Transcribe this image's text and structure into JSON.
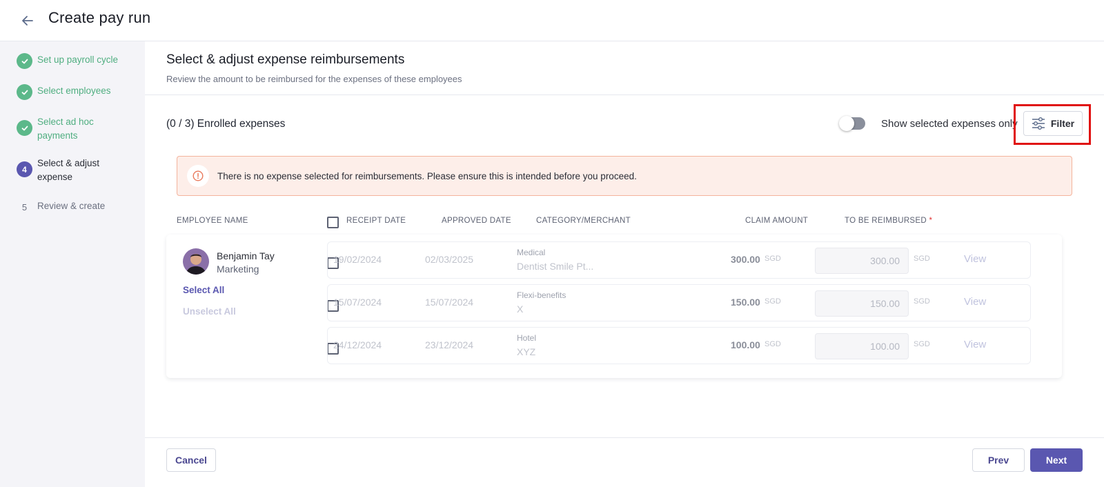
{
  "header": {
    "title": "Create pay run"
  },
  "sidebar": {
    "steps": [
      {
        "number": "1",
        "label": "Set up payroll cycle",
        "state": "done"
      },
      {
        "number": "2",
        "label": "Select employees",
        "state": "done"
      },
      {
        "number": "3",
        "label": "Select ad hoc payments",
        "state": "done"
      },
      {
        "number": "4",
        "label": "Select & adjust expense",
        "state": "active"
      },
      {
        "number": "5",
        "label": "Review & create",
        "state": "pending"
      }
    ]
  },
  "main": {
    "title": "Select & adjust expense reimbursements",
    "subtitle": "Review the amount to be reimbursed for the expenses of these employees",
    "enrolled_count": "(0 / 3) Enrolled expenses",
    "toggle_label": "Show selected expenses only",
    "filter_label": "Filter",
    "alert_text": "There is no expense selected for reimbursements. Please ensure this is intended before you proceed.",
    "columns": {
      "employee_name": "EMPLOYEE NAME",
      "receipt_date": "RECEIPT DATE",
      "approved_date": "APPROVED DATE",
      "category_merchant": "CATEGORY/MERCHANT",
      "claim_amount": "CLAIM AMOUNT",
      "to_be_reimbursed": "TO BE REIMBURSED",
      "required_mark": "*"
    },
    "employee": {
      "name": "Benjamin Tay",
      "department": "Marketing",
      "select_all": "Select All",
      "unselect_all": "Unselect All"
    },
    "expenses": [
      {
        "receipt_date": "19/02/2024",
        "approved_date": "02/03/2025",
        "category": "Medical",
        "merchant": "Dentist Smile Pt...",
        "claim_amount": "300.00",
        "currency": "SGD",
        "reimburse": "300.00",
        "currency2": "SGD",
        "view": "View"
      },
      {
        "receipt_date": "15/07/2024",
        "approved_date": "15/07/2024",
        "category": "Flexi-benefits",
        "merchant": "X",
        "claim_amount": "150.00",
        "currency": "SGD",
        "reimburse": "150.00",
        "currency2": "SGD",
        "view": "View"
      },
      {
        "receipt_date": "24/12/2024",
        "approved_date": "23/12/2024",
        "category": "Hotel",
        "merchant": "XYZ",
        "claim_amount": "100.00",
        "currency": "SGD",
        "reimburse": "100.00",
        "currency2": "SGD",
        "view": "View"
      }
    ]
  },
  "footer": {
    "cancel": "Cancel",
    "prev": "Prev",
    "next": "Next"
  },
  "colors": {
    "accent": "#5a57b0",
    "success": "#5cb88a",
    "alert_bg": "#fdeee9",
    "highlight": "#e01010"
  }
}
